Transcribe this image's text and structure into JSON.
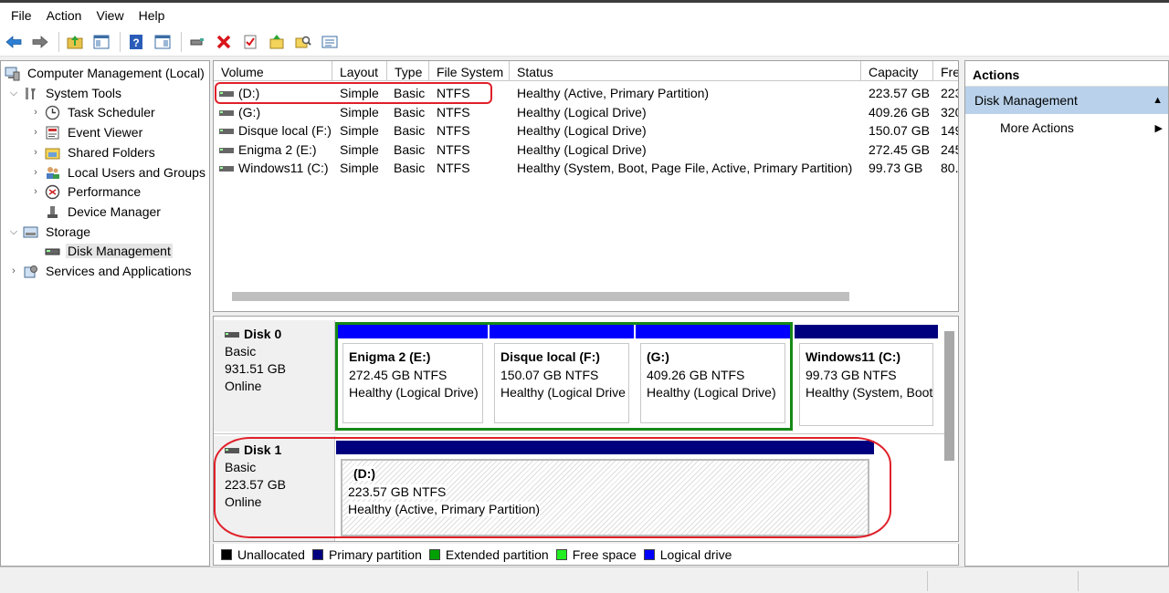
{
  "menu": [
    "File",
    "Action",
    "View",
    "Help"
  ],
  "toolbar_icons": [
    "back-arrow-icon",
    "forward-arrow-icon",
    "up-folder-icon",
    "show-tree-icon",
    "help-icon",
    "properties-view-icon",
    "connect-icon",
    "delete-icon",
    "check-icon",
    "folder-up-icon",
    "search-folder-icon",
    "list-icon"
  ],
  "tree": {
    "root": "Computer Management (Local)",
    "system_tools": "System Tools",
    "task_scheduler": "Task Scheduler",
    "event_viewer": "Event Viewer",
    "shared_folders": "Shared Folders",
    "local_users": "Local Users and Groups",
    "performance": "Performance",
    "device_manager": "Device Manager",
    "storage": "Storage",
    "disk_management": "Disk Management",
    "services": "Services and Applications"
  },
  "columns": {
    "volume": "Volume",
    "layout": "Layout",
    "type": "Type",
    "fs": "File System",
    "status": "Status",
    "capacity": "Capacity",
    "free": "Fre"
  },
  "volumes": [
    {
      "volume": "(D:)",
      "layout": "Simple",
      "type": "Basic",
      "fs": "NTFS",
      "status": "Healthy (Active, Primary Partition)",
      "capacity": "223.57 GB",
      "free": "223"
    },
    {
      "volume": "(G:)",
      "layout": "Simple",
      "type": "Basic",
      "fs": "NTFS",
      "status": "Healthy (Logical Drive)",
      "capacity": "409.26 GB",
      "free": "320"
    },
    {
      "volume": "Disque local (F:)",
      "layout": "Simple",
      "type": "Basic",
      "fs": "NTFS",
      "status": "Healthy (Logical Drive)",
      "capacity": "150.07 GB",
      "free": "149"
    },
    {
      "volume": "Enigma 2 (E:)",
      "layout": "Simple",
      "type": "Basic",
      "fs": "NTFS",
      "status": "Healthy (Logical Drive)",
      "capacity": "272.45 GB",
      "free": "245"
    },
    {
      "volume": "Windows11 (C:)",
      "layout": "Simple",
      "type": "Basic",
      "fs": "NTFS",
      "status": "Healthy (System, Boot, Page File, Active, Primary Partition)",
      "capacity": "99.73 GB",
      "free": "80."
    }
  ],
  "disks": [
    {
      "name": "Disk 0",
      "type": "Basic",
      "size": "931.51 GB",
      "state": "Online",
      "partitions": [
        {
          "title": "Enigma 2  (E:)",
          "size": "272.45 GB NTFS",
          "status": "Healthy (Logical Drive)"
        },
        {
          "title": "Disque local  (F:)",
          "size": "150.07 GB NTFS",
          "status": "Healthy (Logical Drive"
        },
        {
          "title": "(G:)",
          "size": "409.26 GB NTFS",
          "status": "Healthy (Logical Drive)"
        },
        {
          "title": "Windows11  (C:)",
          "size": "99.73 GB NTFS",
          "status": "Healthy (System, Boot"
        }
      ]
    },
    {
      "name": "Disk 1",
      "type": "Basic",
      "size": "223.57 GB",
      "state": "Online",
      "partitions": [
        {
          "title": "(D:)",
          "size": "223.57 GB NTFS",
          "status": "Healthy (Active, Primary Partition)"
        }
      ]
    }
  ],
  "legend": [
    {
      "label": "Unallocated",
      "color": "#000000"
    },
    {
      "label": "Primary partition",
      "color": "#00007f"
    },
    {
      "label": "Extended partition",
      "color": "#00a000"
    },
    {
      "label": "Free space",
      "color": "#22ee22"
    },
    {
      "label": "Logical drive",
      "color": "#0000ff"
    }
  ],
  "actions": {
    "header": "Actions",
    "section": "Disk Management",
    "more": "More Actions"
  },
  "colors": {
    "primary": "#00007f",
    "logical": "#0000ff",
    "extended": "#008000",
    "annotation": "#e0202a",
    "selection": "#b9d1ea"
  }
}
